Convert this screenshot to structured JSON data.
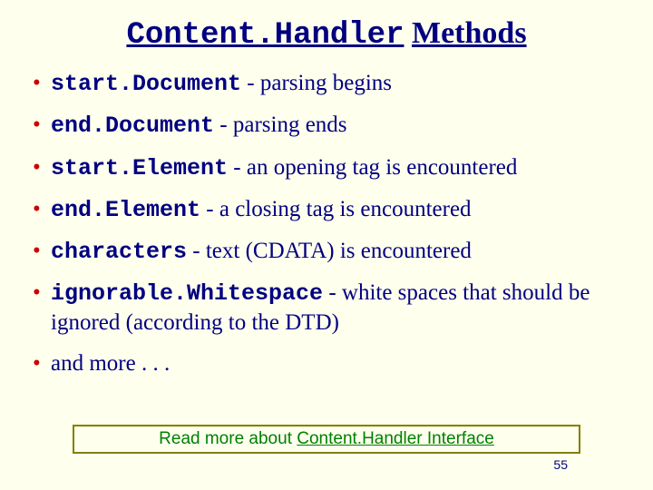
{
  "title": {
    "class_name": "Content.Handler",
    "word": "Methods"
  },
  "bullets": [
    {
      "name": "start.Document",
      "desc": " - parsing begins"
    },
    {
      "name": "end.Document",
      "desc": " - parsing ends"
    },
    {
      "name": "start.Element",
      "desc": " - an opening tag is encountered"
    },
    {
      "name": "end.Element",
      "desc": " - a closing tag is encountered"
    },
    {
      "name": "characters",
      "desc": " - text (CDATA) is encountered"
    },
    {
      "name": "ignorable.Whitespace",
      "desc": " - white spaces that should be ignored (according to the DTD)"
    }
  ],
  "and_more": "and more . . .",
  "footer": {
    "prefix": "Read more about ",
    "link": "Content.Handler Interface"
  },
  "page_number": "55"
}
